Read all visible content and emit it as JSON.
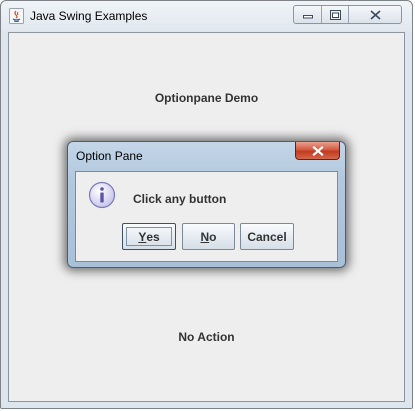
{
  "window": {
    "title": "Java Swing Examples",
    "controls": {
      "minimize": "minimize-icon",
      "maximize": "maximize-icon",
      "close": "close-icon"
    }
  },
  "main": {
    "demo_label": "Optionpane Demo",
    "action_label": "No Action"
  },
  "dialog": {
    "title": "Option Pane",
    "message": "Click any button",
    "icon": "info-icon",
    "buttons": {
      "yes": {
        "mnemonic": "Y",
        "rest": "es"
      },
      "no": {
        "mnemonic": "N",
        "rest": "o"
      },
      "cancel": "Cancel"
    }
  },
  "colors": {
    "close_button": "#c94a31",
    "dialog_frame": "#b2c8de",
    "content_bg": "#eeeeee"
  }
}
